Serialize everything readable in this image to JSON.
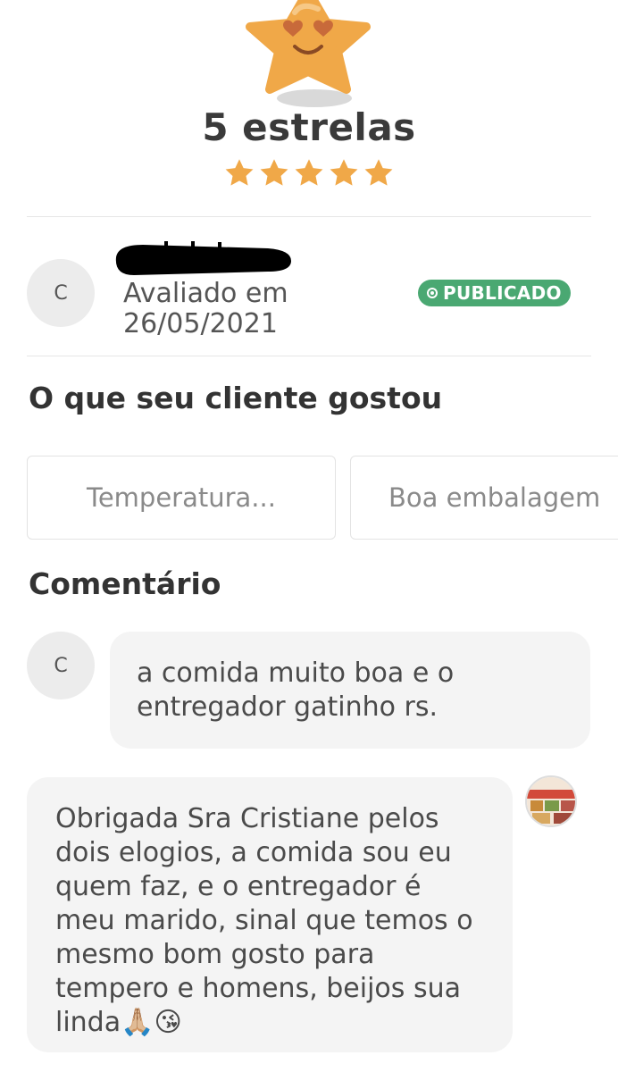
{
  "header": {
    "rating_title": "5 estrelas",
    "star_count": 5,
    "accent_color": "#f0a848"
  },
  "reviewer": {
    "initial": "C",
    "date_label": "Avaliado em",
    "date": "26/05/2021",
    "status": "PUBLICADO",
    "status_color": "#4aa872"
  },
  "liked": {
    "title": "O que seu cliente gostou",
    "chips": [
      "Temperatura...",
      "Boa embalagem"
    ]
  },
  "comments": {
    "title": "Comentário",
    "customer_initial": "C",
    "customer_text": "a comida muito boa e o entregador gatinho rs.",
    "reply_text": "Obrigada Sra Cristiane pelos dois elogios, a comida sou eu quem faz, e o entregador é meu marido, sinal que temos o mesmo bom gosto para tempero e homens, beijos sua linda🙏🏼😘"
  }
}
